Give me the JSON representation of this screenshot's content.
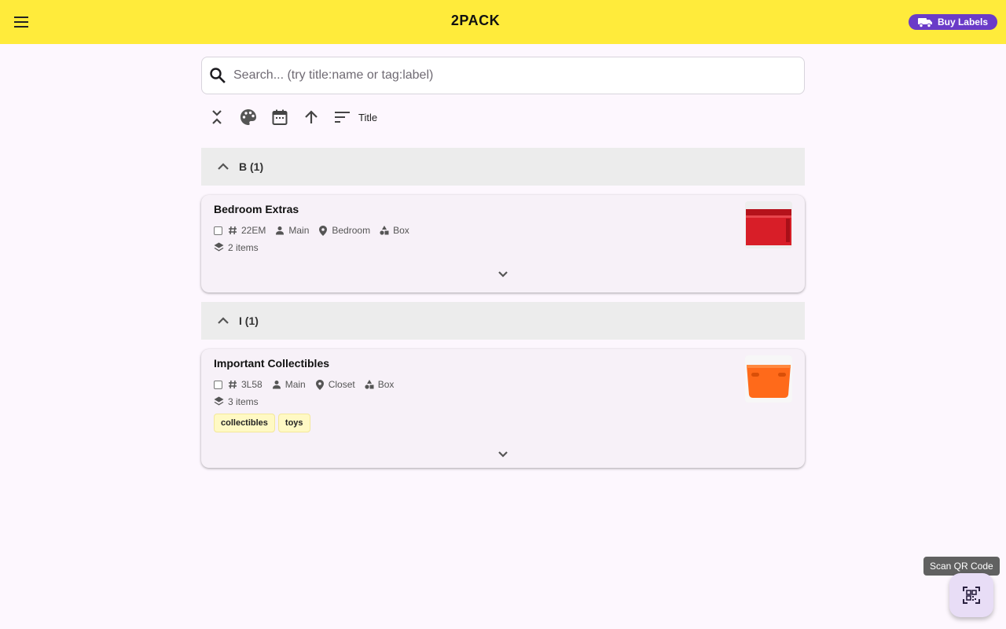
{
  "appbar": {
    "title": "2PACK",
    "buy_labels": "Buy Labels"
  },
  "search": {
    "placeholder": "Search... (try title:name or tag:label)",
    "value": ""
  },
  "toolbar": {
    "sort_label": "Title"
  },
  "groups": [
    {
      "title": "B (1)",
      "cards": [
        {
          "title": "Bedroom Extras",
          "code": "22EM",
          "owner": "Main",
          "location": "Bedroom",
          "type": "Box",
          "items": "2 items",
          "tags": [],
          "thumb_color": "#d81e28"
        }
      ]
    },
    {
      "title": "I (1)",
      "cards": [
        {
          "title": "Important Collectibles",
          "code": "3L58",
          "owner": "Main",
          "location": "Closet",
          "type": "Box",
          "items": "3 items",
          "tags": [
            "collectibles",
            "toys"
          ],
          "thumb_color": "#ff6a1a"
        }
      ]
    }
  ],
  "fab": {
    "tooltip": "Scan QR Code"
  },
  "colors": {
    "appbar": "#ffeb3b",
    "accent": "#6a3bc8",
    "tag_bg": "#fff9c4"
  }
}
